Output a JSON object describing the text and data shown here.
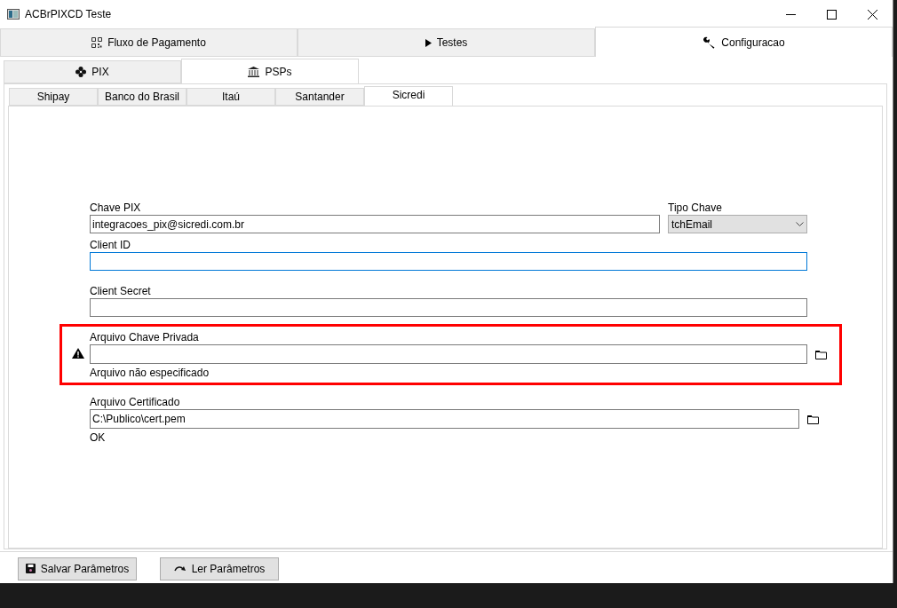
{
  "window": {
    "title": "ACBrPIXCD Teste"
  },
  "main_tabs": [
    {
      "label": "Fluxo de Pagamento",
      "selected": false
    },
    {
      "label": "Testes",
      "selected": false
    },
    {
      "label": "Configuracao",
      "selected": true
    }
  ],
  "config_tabs": [
    {
      "label": "PIX",
      "selected": false
    },
    {
      "label": "PSPs",
      "selected": true
    }
  ],
  "psp_tabs": [
    {
      "label": "Shipay",
      "selected": false
    },
    {
      "label": "Banco do Brasil",
      "selected": false
    },
    {
      "label": "Itaú",
      "selected": false
    },
    {
      "label": "Santander",
      "selected": false
    },
    {
      "label": "Sicredi",
      "selected": true
    }
  ],
  "key_row": {
    "chave_pix": {
      "label": "Chave PIX",
      "value": "integracoes_pix@sicredi.com.br"
    },
    "tipo_chave": {
      "label": "Tipo Chave",
      "value": "tchEmail"
    }
  },
  "fields": [
    {
      "kind": "text",
      "label": "Client ID",
      "focused": true
    },
    {
      "kind": "text",
      "label": "Client Secret",
      "focused": false
    },
    {
      "kind": "file",
      "label": "Arquivo Chave Privada",
      "status": "Arquivo não especificado",
      "warning": true,
      "highlighted": true
    },
    {
      "kind": "file",
      "label": "Arquivo Certificado",
      "value": "C:\\Publico\\cert.pem",
      "status": "OK",
      "warning": false,
      "highlighted": false
    }
  ],
  "buttons": [
    {
      "label": "Salvar Parâmetros"
    },
    {
      "label": "Ler Parâmetros"
    }
  ]
}
